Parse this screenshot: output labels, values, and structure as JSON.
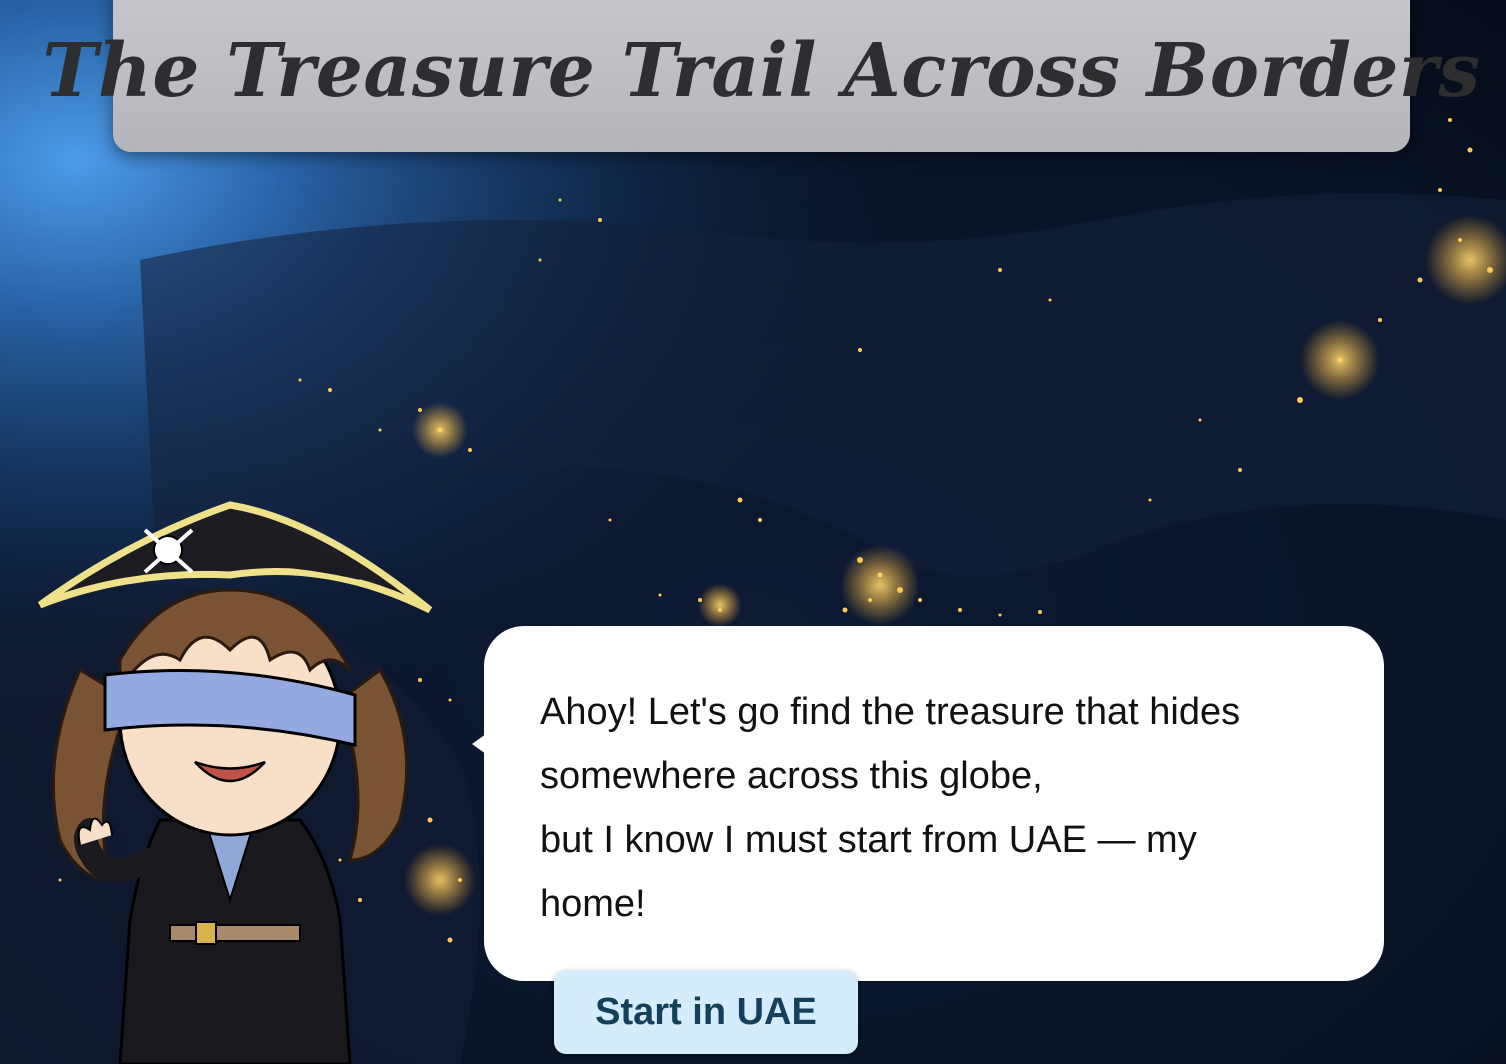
{
  "title": "The Treasure Trail Across Borders",
  "dialogue": {
    "line1": "Ahoy! Let's go find the treasure that hides",
    "line2": "somewhere across this globe,",
    "line3": "but I know I must start from UAE — my",
    "line4": "home!"
  },
  "start_button_label": "Start in UAE",
  "colors": {
    "title_banner": "#bfc0c5",
    "title_text": "#2e2e30",
    "bubble": "#ffffff",
    "button_bg": "#d4ecfb",
    "button_text": "#163f5a",
    "city_lights": "#ffcc55"
  }
}
